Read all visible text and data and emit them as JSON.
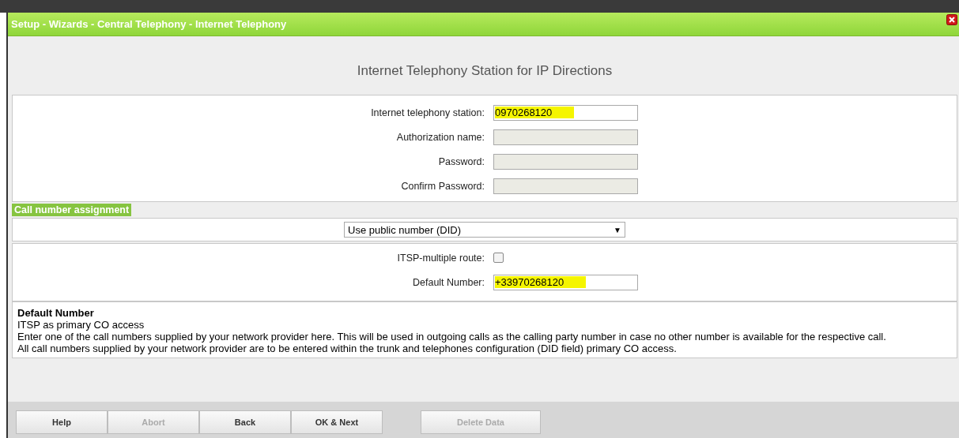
{
  "window": {
    "title": "Setup - Wizards - Central Telephony - Internet Telephony"
  },
  "heading": "Internet Telephony Station for IP Directions",
  "station_fields": [
    {
      "kind": "text",
      "label": "Internet telephony station:",
      "value": "0970268120",
      "highlighted": true,
      "disabled": false
    },
    {
      "kind": "text",
      "label": "Authorization name:",
      "disabled": true
    },
    {
      "kind": "text",
      "label": "Password:",
      "disabled": true
    },
    {
      "kind": "text",
      "label": "Confirm Password:",
      "disabled": true
    }
  ],
  "section": {
    "title": "Call number assignment",
    "dropdown": {
      "value": "Use public number (DID)",
      "arrow": "▼"
    }
  },
  "route_fields": [
    {
      "kind": "checkbox",
      "label": "ITSP-multiple route:",
      "checked": false
    },
    {
      "kind": "text",
      "label": "Default Number:",
      "value": "+33970268120",
      "highlighted": true,
      "disabled": false
    }
  ],
  "help": {
    "title": "Default Number",
    "lines": [
      "ITSP as primary CO access",
      "Enter one of the call numbers supplied by your network provider here. This will be used in outgoing calls as the calling party number in case no other number is available for the respective call.",
      "All call numbers supplied by your network provider are to be entered within the trunk and telephones configuration (DID field) primary CO access."
    ]
  },
  "buttons": [
    {
      "label": "Help",
      "disabled": false,
      "kind": "main"
    },
    {
      "label": "Abort",
      "disabled": true,
      "kind": "main"
    },
    {
      "label": "Back",
      "disabled": false,
      "kind": "main"
    },
    {
      "label": "OK & Next",
      "disabled": false,
      "kind": "main"
    },
    {
      "label": "Delete Data",
      "disabled": true,
      "kind": "extra"
    }
  ]
}
